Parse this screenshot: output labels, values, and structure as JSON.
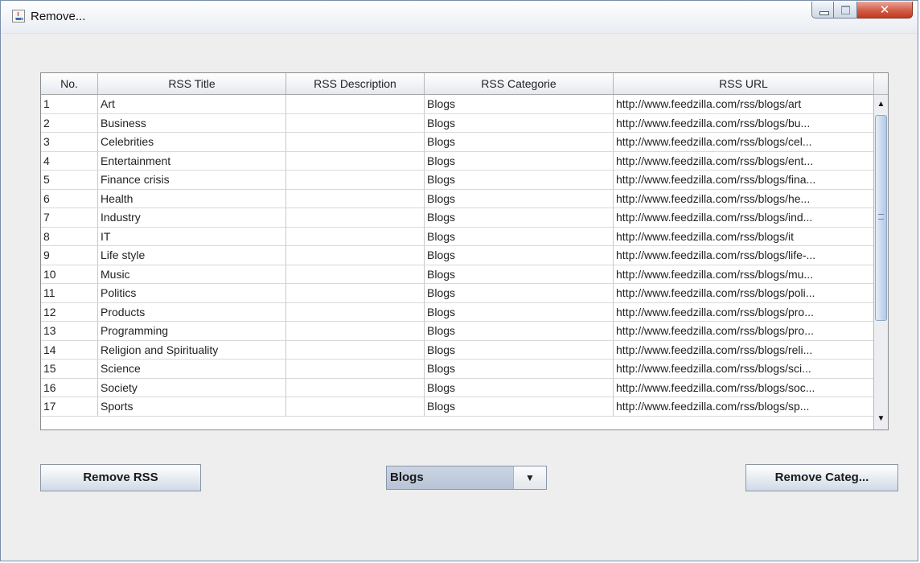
{
  "window": {
    "title": "Remove..."
  },
  "table": {
    "headers": [
      "No.",
      "RSS Title",
      "RSS Description",
      "RSS Categorie",
      "RSS URL"
    ],
    "rows": [
      [
        "1",
        "Art",
        "",
        "Blogs",
        "http://www.feedzilla.com/rss/blogs/art"
      ],
      [
        "2",
        "Business",
        "",
        "Blogs",
        "http://www.feedzilla.com/rss/blogs/bu..."
      ],
      [
        "3",
        "Celebrities",
        "",
        "Blogs",
        "http://www.feedzilla.com/rss/blogs/cel..."
      ],
      [
        "4",
        "Entertainment",
        "",
        "Blogs",
        "http://www.feedzilla.com/rss/blogs/ent..."
      ],
      [
        "5",
        "Finance crisis",
        "",
        "Blogs",
        "http://www.feedzilla.com/rss/blogs/fina..."
      ],
      [
        "6",
        "Health",
        "",
        "Blogs",
        "http://www.feedzilla.com/rss/blogs/he..."
      ],
      [
        "7",
        "Industry",
        "",
        "Blogs",
        "http://www.feedzilla.com/rss/blogs/ind..."
      ],
      [
        "8",
        "IT",
        "",
        "Blogs",
        "http://www.feedzilla.com/rss/blogs/it"
      ],
      [
        "9",
        "Life style",
        "",
        "Blogs",
        "http://www.feedzilla.com/rss/blogs/life-..."
      ],
      [
        "10",
        "Music",
        "",
        "Blogs",
        "http://www.feedzilla.com/rss/blogs/mu..."
      ],
      [
        "11",
        "Politics",
        "",
        "Blogs",
        "http://www.feedzilla.com/rss/blogs/poli..."
      ],
      [
        "12",
        "Products",
        "",
        "Blogs",
        "http://www.feedzilla.com/rss/blogs/pro..."
      ],
      [
        "13",
        "Programming",
        "",
        "Blogs",
        "http://www.feedzilla.com/rss/blogs/pro..."
      ],
      [
        "14",
        "Religion and Spirituality",
        "",
        "Blogs",
        "http://www.feedzilla.com/rss/blogs/reli..."
      ],
      [
        "15",
        "Science",
        "",
        "Blogs",
        "http://www.feedzilla.com/rss/blogs/sci..."
      ],
      [
        "16",
        "Society",
        "",
        "Blogs",
        "http://www.feedzilla.com/rss/blogs/soc..."
      ],
      [
        "17",
        "Sports",
        "",
        "Blogs",
        "http://www.feedzilla.com/rss/blogs/sp..."
      ]
    ]
  },
  "buttons": {
    "remove_rss": "Remove RSS",
    "remove_category": "Remove Categ..."
  },
  "category_select": {
    "selected": "Blogs"
  },
  "icons": {
    "app": "java-app-icon",
    "minimize": "minimize-icon",
    "maximize": "maximize-icon",
    "close": "close-icon",
    "scroll_up": "scroll-up-arrow-icon",
    "scroll_down": "scroll-down-arrow-icon",
    "dropdown": "chevron-down-icon"
  },
  "colors": {
    "window_bg": "#eeeeee",
    "close_button": "#c13a22",
    "scroll_thumb": "#c5d7ee"
  }
}
